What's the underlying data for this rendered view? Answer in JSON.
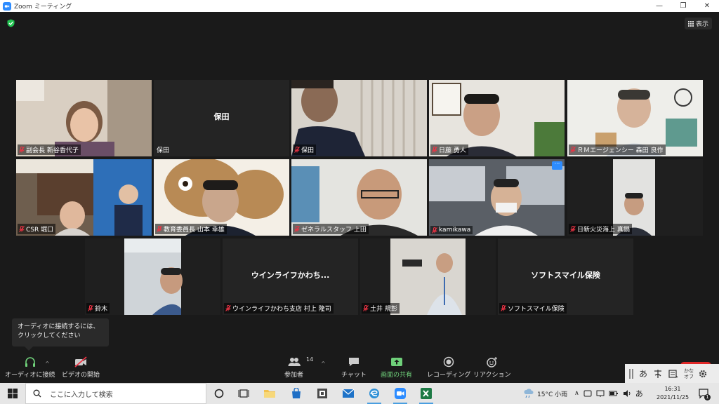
{
  "window": {
    "title": "Zoom ミーティング",
    "controls": [
      "—",
      "❐",
      "✕"
    ]
  },
  "view_button": {
    "label": "表示"
  },
  "participants": [
    {
      "name": "副会長 新谷香代子",
      "center": ""
    },
    {
      "name": "保田",
      "center": "保田"
    },
    {
      "name": "保田",
      "center": ""
    },
    {
      "name": "日藤 勇人",
      "center": ""
    },
    {
      "name": "ＲＭエージェンシー 森田 良作",
      "center": ""
    },
    {
      "name": "CSR 堀口",
      "center": ""
    },
    {
      "name": "教育委員長 山本 幸雄",
      "center": ""
    },
    {
      "name": "ゼネラルスタッフ 上田",
      "center": ""
    },
    {
      "name": "kamikawa",
      "center": ""
    },
    {
      "name": "日新火災海上 真鍋",
      "center": ""
    },
    {
      "name": "鈴木",
      "center": ""
    },
    {
      "name": "ウインライフかわち支店 村上 隆司",
      "center": "ウインライフかわち..."
    },
    {
      "name": "土井 規彰",
      "center": ""
    },
    {
      "name": "ソフトスマイル保険",
      "center": "ソフトスマイル保険"
    }
  ],
  "tile_menu": "···",
  "tooltip": {
    "text": "オーディオに接続するには、クリックしてください"
  },
  "toolbar": {
    "audio": "オーディオに接続",
    "video": "ビデオの開始",
    "participants": "参加者",
    "participants_count": "14",
    "chat": "チャット",
    "share": "画面の共有",
    "record": "レコーディング",
    "reactions": "リアクション",
    "caret": "^"
  },
  "ime": {
    "a": "あ",
    "kana_top": "かな",
    "kana_bottom": "オフ"
  },
  "taskbar": {
    "search_placeholder": "ここに入力して検索",
    "weather": "15°C 小雨",
    "ime_mode": "あ",
    "time": "16:31",
    "date": "2021/11/25",
    "notif_count": "1"
  },
  "colors": {
    "active_speaker": "#d5e84a",
    "share_green": "#6fd07a",
    "zoom_blue": "#2d8cff"
  }
}
